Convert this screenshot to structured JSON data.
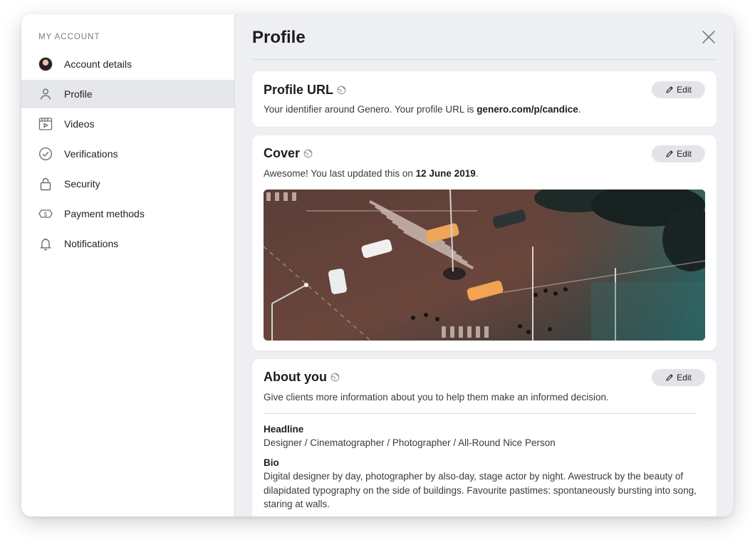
{
  "sidebar": {
    "heading": "MY ACCOUNT",
    "items": [
      {
        "label": "Account details",
        "icon": "avatar"
      },
      {
        "label": "Profile",
        "icon": "user-icon",
        "active": true
      },
      {
        "label": "Videos",
        "icon": "video-icon"
      },
      {
        "label": "Verifications",
        "icon": "check-circle-icon"
      },
      {
        "label": "Security",
        "icon": "lock-icon"
      },
      {
        "label": "Payment methods",
        "icon": "dollar-bill-icon"
      },
      {
        "label": "Notifications",
        "icon": "bell-icon"
      }
    ]
  },
  "main": {
    "title": "Profile",
    "edit_label": "Edit",
    "profile_url": {
      "title": "Profile URL",
      "text_prefix": "Your identifier around Genero. Your profile URL is ",
      "url": "genero.com/p/candice",
      "text_suffix": "."
    },
    "cover": {
      "title": "Cover",
      "text_prefix": "Awesome! You last updated this on ",
      "date": "12 June 2019",
      "text_suffix": "."
    },
    "about": {
      "title": "About you",
      "intro": "Give clients more information about you to help them make an informed decision.",
      "headline_label": "Headline",
      "headline_value": "Designer / Cinematographer / Photographer / All-Round Nice Person",
      "bio_label": "Bio",
      "bio_value": "Digital designer by day, photographer by also-day, stage actor by night. Awestruck by the beauty of dilapidated typography on the side of buildings. Favourite pastimes: spontaneously bursting into song, staring at walls."
    }
  },
  "colors": {
    "sidebar_active": "#e6e7eb",
    "panel_bg": "#eeeff3",
    "edit_button_bg": "#e3e4e8"
  }
}
